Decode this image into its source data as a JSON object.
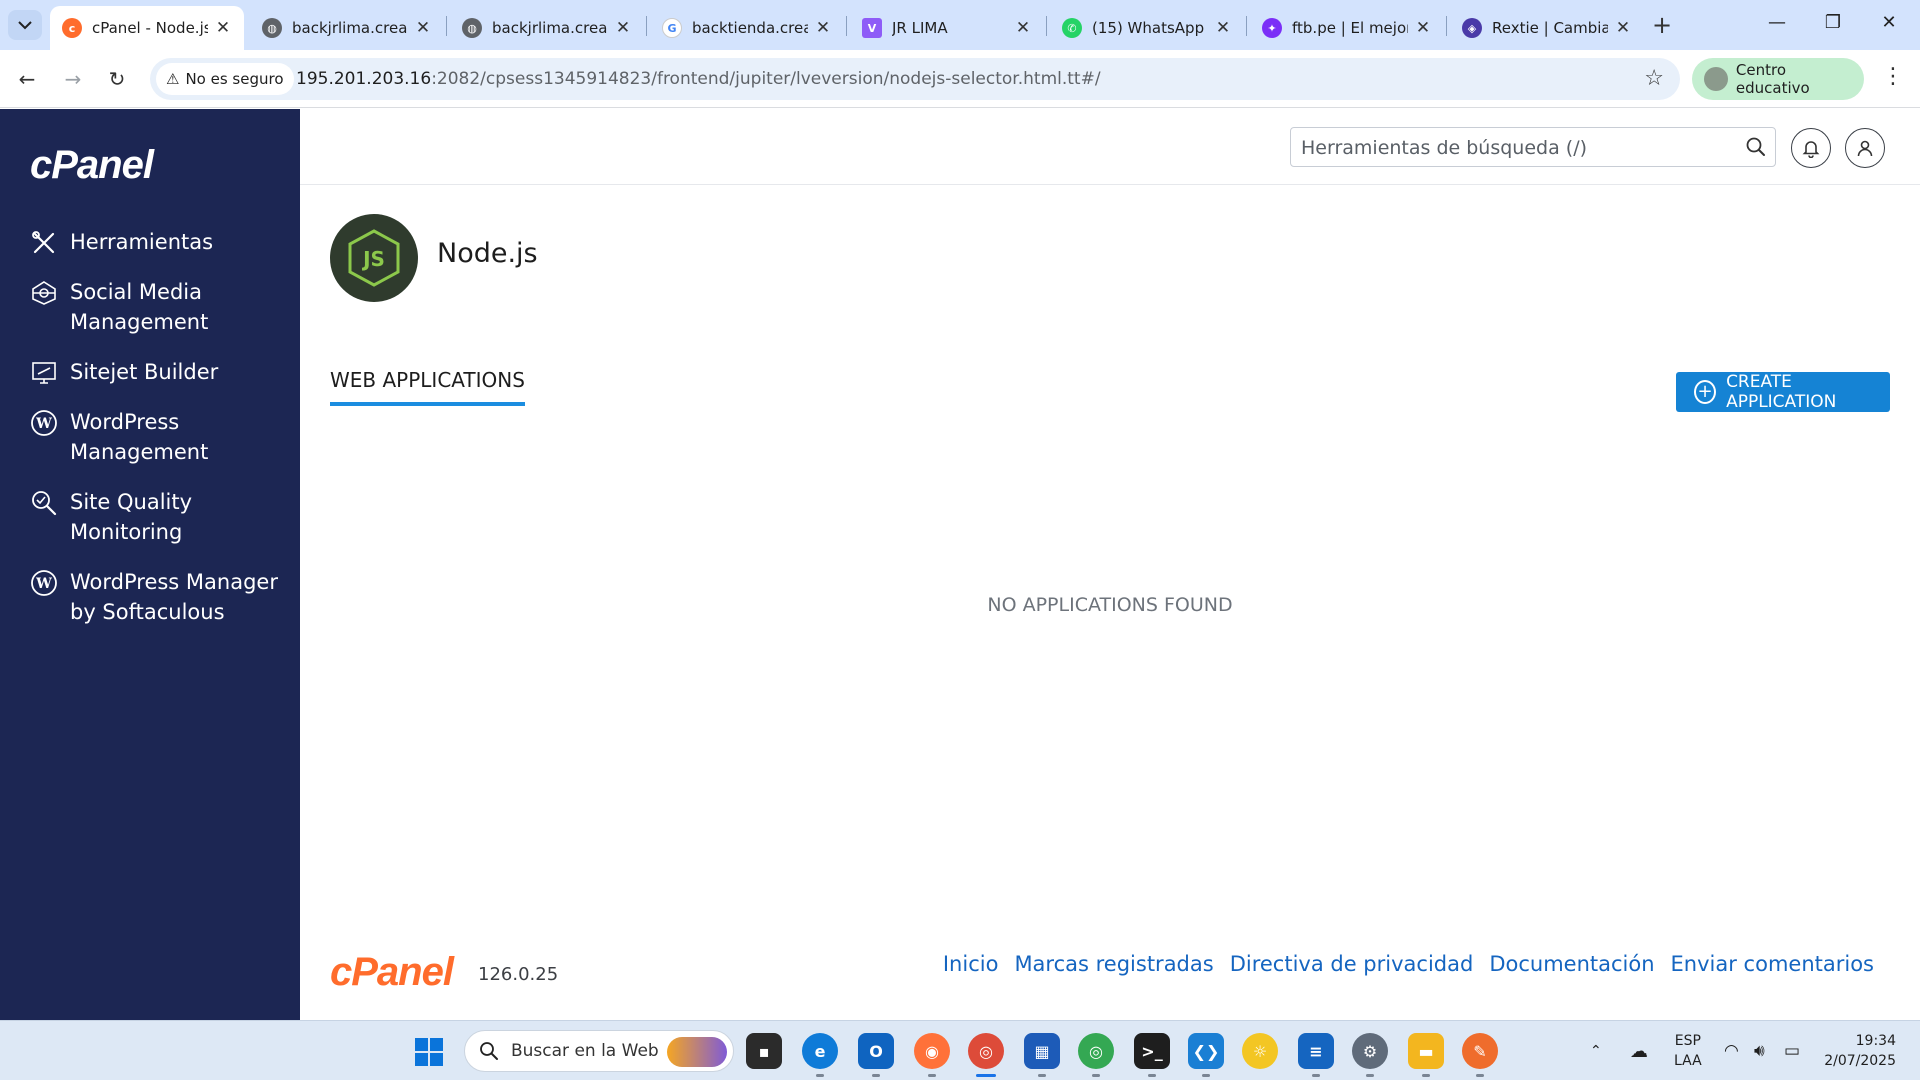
{
  "browser": {
    "tabs": [
      {
        "title": "cPanel - Node.js",
        "active": true
      },
      {
        "title": "backjrlima.crear"
      },
      {
        "title": "backjrlima.crear"
      },
      {
        "title": "backtienda.crear"
      },
      {
        "title": "JR LIMA"
      },
      {
        "title": "(15) WhatsApp"
      },
      {
        "title": "ftb.pe | El mejor"
      },
      {
        "title": "Rextie | Cambia"
      }
    ],
    "security_label": "No es seguro",
    "url_host": "195.201.203.16",
    "url_rest": ":2082/cpsess1345914823/frontend/jupiter/lveversion/nodejs-selector.html.tt#/",
    "profile_label": "Centro educativo"
  },
  "sidebar": {
    "logo": "cPanel",
    "items": [
      {
        "label": "Herramientas",
        "icon": "tools-icon"
      },
      {
        "label": "Social Media Management",
        "icon": "social-media-icon"
      },
      {
        "label": "Sitejet Builder",
        "icon": "sitejet-icon"
      },
      {
        "label": "WordPress Management",
        "icon": "wordpress-icon"
      },
      {
        "label": "Site Quality Monitoring",
        "icon": "site-quality-icon"
      },
      {
        "label": "WordPress Manager by Softaculous",
        "icon": "wordpress-icon"
      }
    ]
  },
  "header": {
    "search_placeholder": "Herramientas de búsqueda (/)"
  },
  "main": {
    "title": "Node.js",
    "tab_label": "WEB APPLICATIONS",
    "create_button": "CREATE APPLICATION",
    "empty_message": "NO APPLICATIONS FOUND"
  },
  "footer": {
    "logo": "cPanel",
    "version": "126.0.25",
    "links": [
      "Inicio",
      "Marcas registradas",
      "Directiva de privacidad",
      "Documentación",
      "Enviar comentarios"
    ]
  },
  "taskbar": {
    "search_label": "Buscar en la Web",
    "lang_line1": "ESP",
    "lang_line2": "LAA",
    "time": "19:34",
    "date": "2/07/2025"
  },
  "colors": {
    "sidebar_bg": "#1c2653",
    "accent_blue": "#1583d4",
    "cpanel_orange": "#ff6c2c",
    "tab_underline": "#1b8de0"
  }
}
